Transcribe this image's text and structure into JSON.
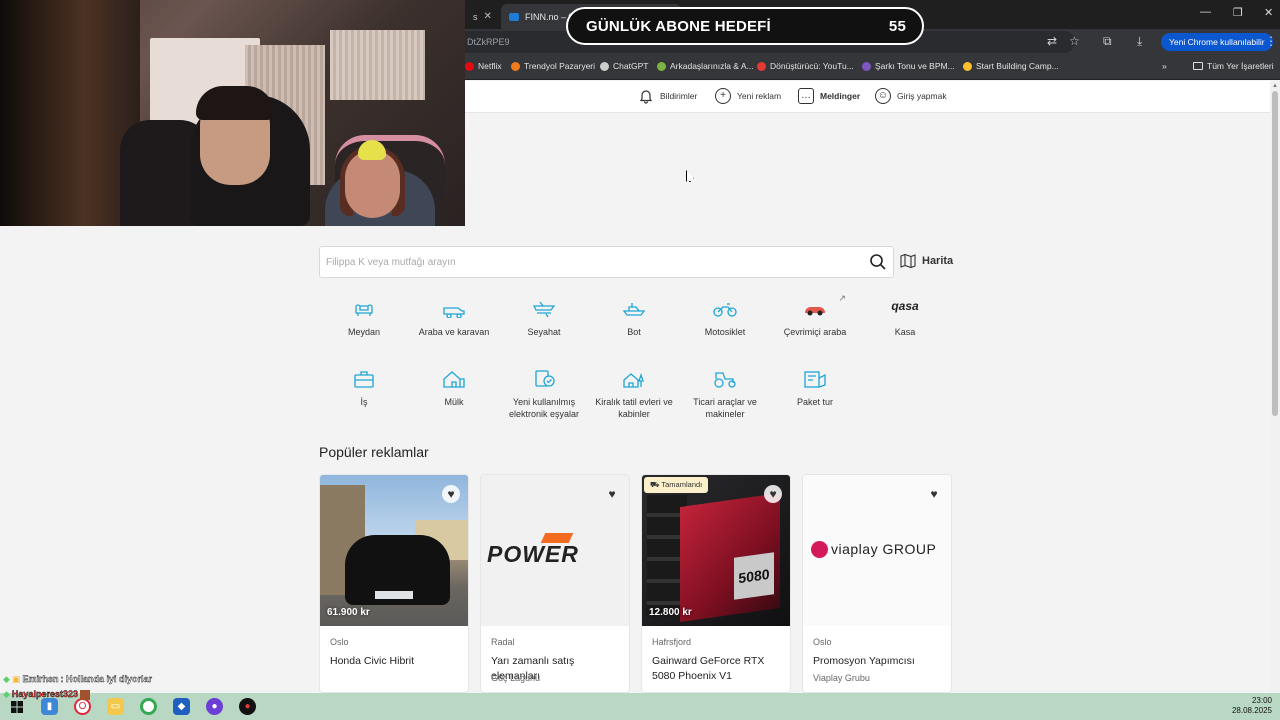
{
  "browser": {
    "tabs": [
      {
        "label": "s",
        "active": false
      },
      {
        "label": "FINN.no – fırsatlar pazarı",
        "active": true
      }
    ],
    "url_fragment": "DtZkRPE9",
    "new_chrome_label": "Yeni Chrome kullanılabilir",
    "bookmarks": [
      {
        "label": "Netflix",
        "color": "#e50914"
      },
      {
        "label": "Trendyol Pazaryeri",
        "color": "#f27a1a"
      },
      {
        "label": "ChatGPT",
        "color": "#cccccc"
      },
      {
        "label": "Arkadaşlarınızla & A...",
        "color": "#7cb342"
      },
      {
        "label": "Dönüştürücü: YouTu...",
        "color": "#e53935"
      },
      {
        "label": "Şarkı Tonu ve BPM...",
        "color": "#7e57c2"
      },
      {
        "label": "Start Building Camp...",
        "color": "#fbc02d"
      }
    ],
    "all_bookmarks_label": "Tüm Yer İşaretleri"
  },
  "stream_overlay": {
    "goal_label": "GÜNLÜK ABONE HEDEFİ",
    "goal_value": "55"
  },
  "finn_header": {
    "nav": [
      {
        "label": "Bildirimler",
        "icon": "bell-icon"
      },
      {
        "label": "Yeni reklam",
        "icon": "plus-circle-icon"
      },
      {
        "label": "Meldinger",
        "icon": "chat-icon"
      },
      {
        "label": "Giriş yapmak",
        "icon": "user-icon"
      }
    ]
  },
  "search": {
    "placeholder": "Filippa K veya mutfağı arayın",
    "map_label": "Harita"
  },
  "categories": [
    {
      "label": "Meydan",
      "icon": "sofa-icon"
    },
    {
      "label": "Araba ve karavan",
      "icon": "car-icon"
    },
    {
      "label": "Seyahat",
      "icon": "plane-icon"
    },
    {
      "label": "Bot",
      "icon": "boat-icon"
    },
    {
      "label": "Motosiklet",
      "icon": "motorcycle-icon"
    },
    {
      "label": "Çevrimiçi araba",
      "icon": "online-car-icon"
    },
    {
      "label": "Kasa",
      "icon": "qasa-logo",
      "logo_text": "qasa"
    },
    {
      "label": "İş",
      "icon": "briefcase-icon"
    },
    {
      "label": "Mülk",
      "icon": "house-icon"
    },
    {
      "label": "Yeni kullanılmış elektronik eşyalar",
      "icon": "electronics-icon"
    },
    {
      "label": "Kiralık tatil evleri ve kabinler",
      "icon": "cabin-icon"
    },
    {
      "label": "Ticari araçlar ve makineler",
      "icon": "tractor-icon"
    },
    {
      "label": "Paket tur",
      "icon": "package-tour-icon"
    }
  ],
  "popular": {
    "title": "Popüler reklamlar",
    "cards": [
      {
        "location": "Oslo",
        "title": "Honda Civic Hibrit",
        "price": "61.900 kr",
        "sub": "",
        "badge": ""
      },
      {
        "location": "Radal",
        "title": "Yarı zamanlı satış elemanları",
        "price": "",
        "sub": "Güç Lagünü",
        "badge": "",
        "logo": "POWER"
      },
      {
        "location": "Hafrsfjord",
        "title": "Gainward GeForce RTX 5080 Phoenix V1",
        "price": "12.800 kr",
        "sub": "",
        "badge": "Tamamlandı"
      },
      {
        "location": "Oslo",
        "title": "Promosyon Yapımcısı",
        "price": "",
        "sub": "Viaplay Grubu",
        "badge": "",
        "logo": "viaplay GROUP"
      }
    ]
  },
  "chat": [
    {
      "user": "Emirhsn",
      "message": ": Hollanda iyi diyorlar"
    },
    {
      "user": "Hayalperest323",
      "message": ""
    }
  ],
  "taskbar": {
    "time": "23:00",
    "date": "28.08.2025"
  }
}
